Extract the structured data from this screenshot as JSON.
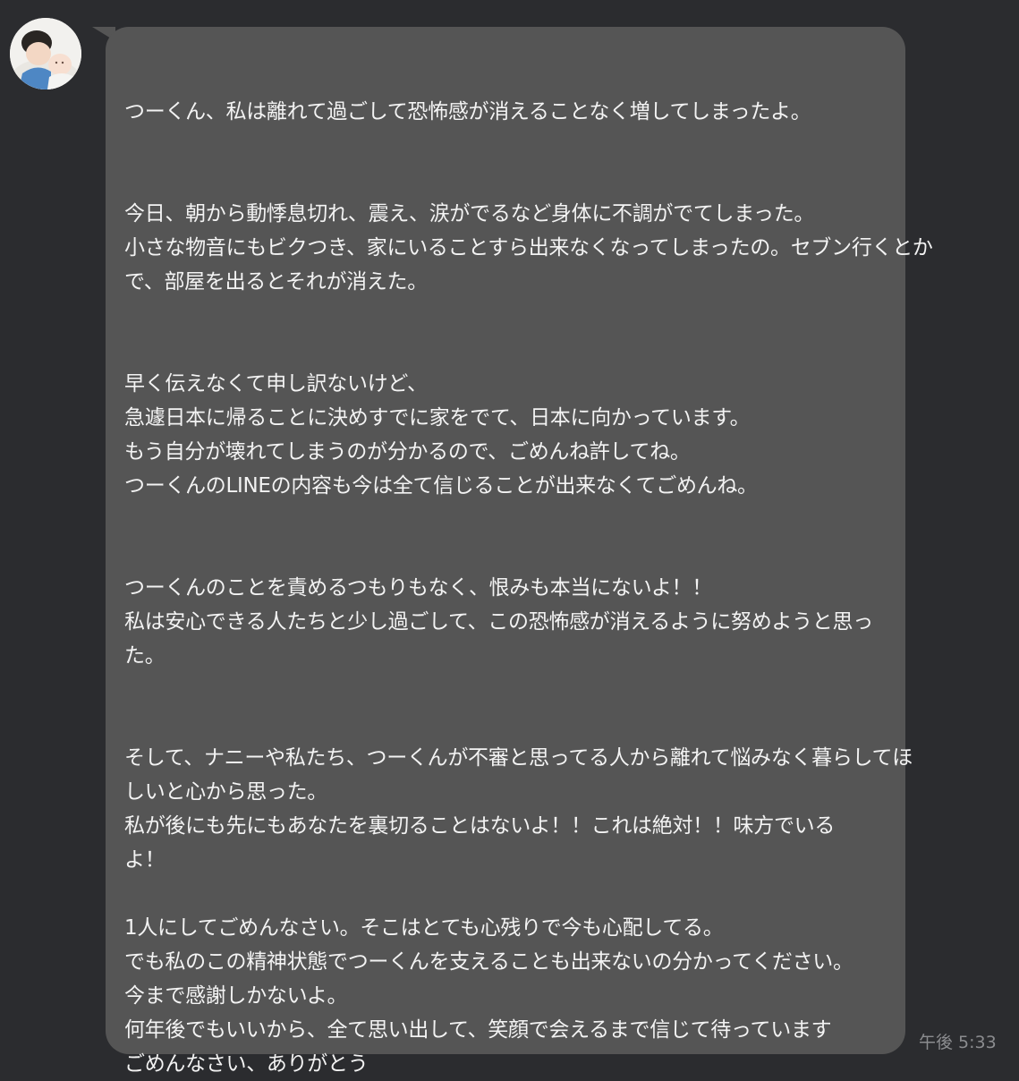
{
  "conversation": {
    "message": {
      "avatar_icon": "user-avatar-photo",
      "lines": [
        "つーくん、私は離れて過ごして恐怖感が消えることなく増してしまったよ。",
        "",
        "",
        "今日、朝から動悸息切れ、震え、涙がでるなど身体に不調がでてしまった。",
        "小さな物音にもビクつき、家にいることすら出来なくなってしまったの。セブン行くとか",
        "で、部屋を出るとそれが消えた。",
        "",
        "",
        "早く伝えなくて申し訳ないけど、",
        "急遽日本に帰ることに決めすでに家をでて、日本に向かっています。",
        "もう自分が壊れてしまうのが分かるので、ごめんね許してね。",
        "つーくんのLINEの内容も今は全て信じることが出来なくてごめんね。",
        "",
        "",
        "つーくんのことを責めるつもりもなく、恨みも本当にないよ！！",
        "私は安心できる人たちと少し過ごして、この恐怖感が消えるように努めようと思っ",
        "た。",
        "",
        "",
        "そして、ナニーや私たち、つーくんが不審と思ってる人から離れて悩みなく暮らしてほ",
        "しいと心から思った。",
        "私が後にも先にもあなたを裏切ることはないよ！！これは絶対！！味方でいる",
        "よ！",
        "",
        "1人にしてごめんなさい。そこはとても心残りで今も心配してる。",
        "でも私のこの精神状態でつーくんを支えることも出来ないの分かってください。",
        "今まで感謝しかないよ。",
        "何年後でもいいから、全て思い出して、笑顔で会えるまで信じて待っています",
        "ごめんなさい、ありがとう"
      ],
      "timestamp": "午後 5:33"
    }
  },
  "colors": {
    "background": "#2b2c2f",
    "bubble": "#555555",
    "text": "#f3f3f3",
    "timestamp": "#8b8c8f"
  }
}
